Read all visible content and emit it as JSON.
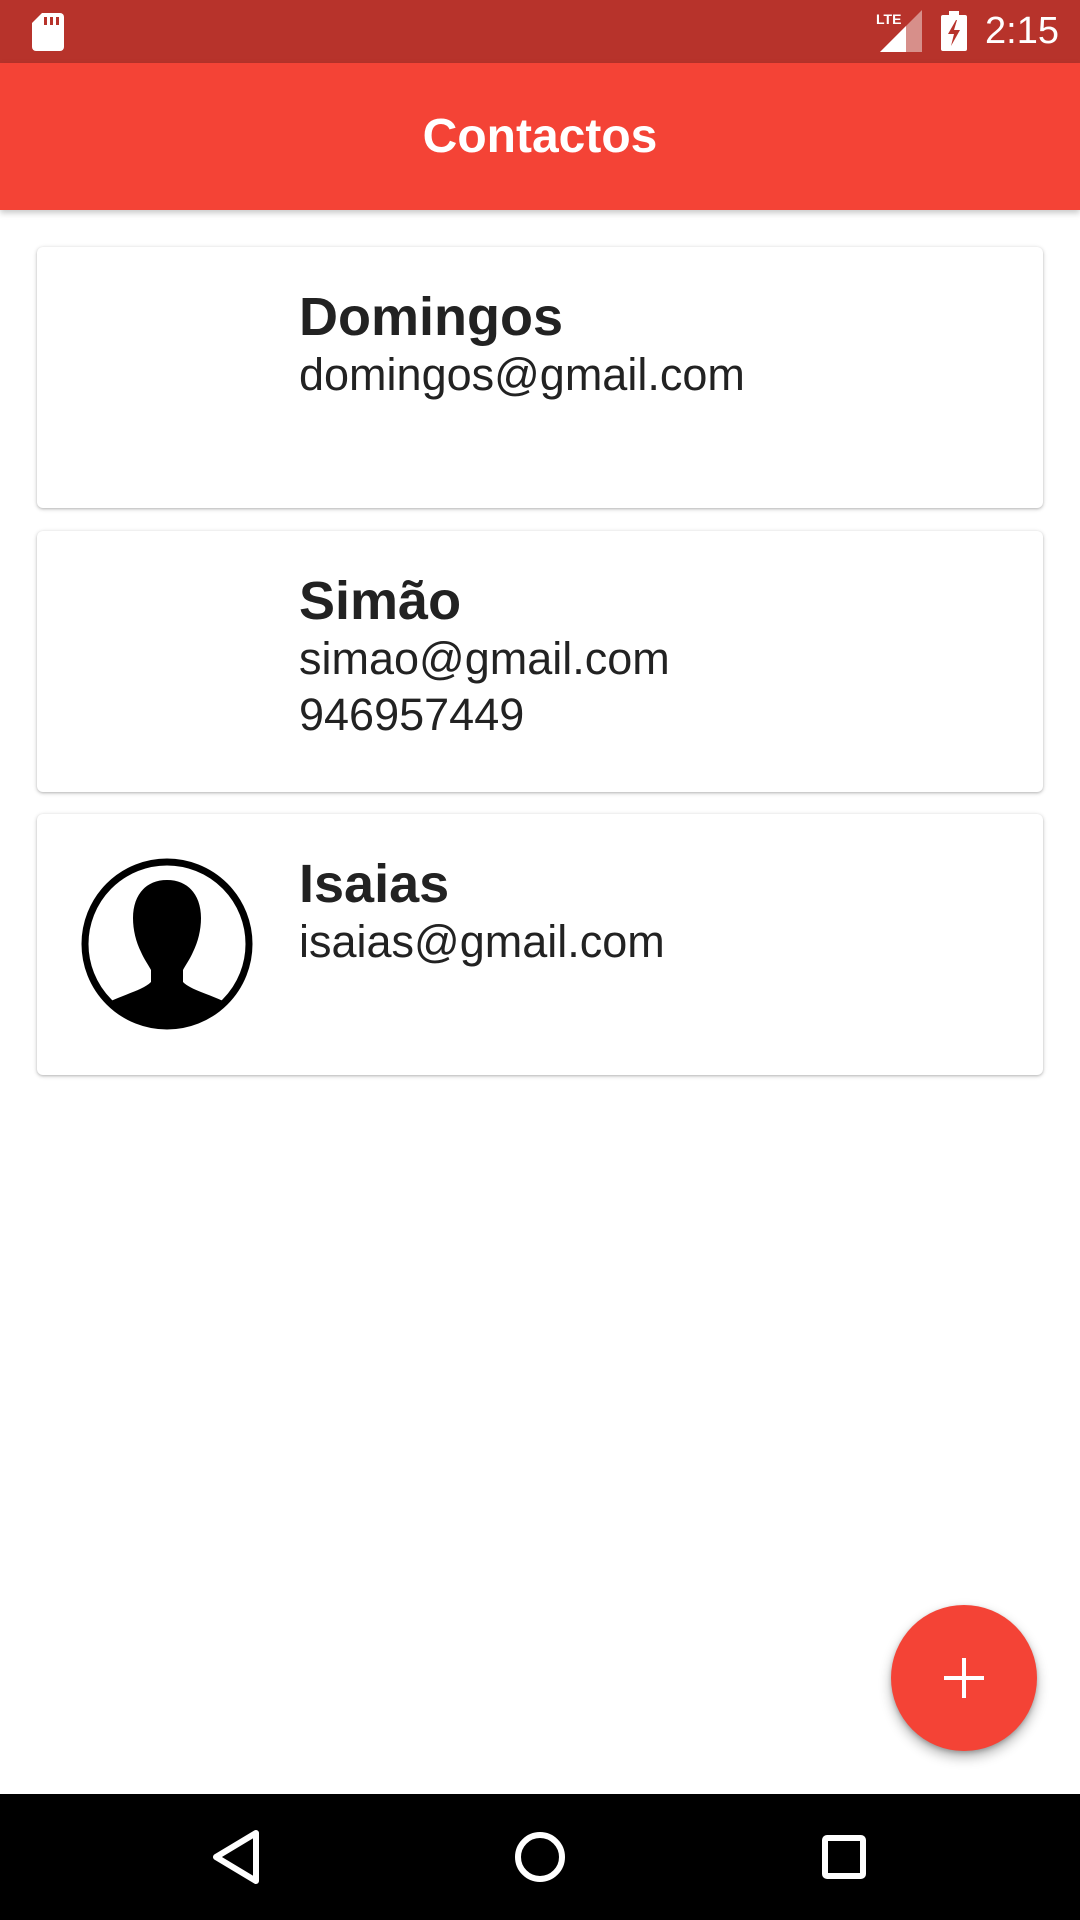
{
  "status_bar": {
    "time": "2:15",
    "network": "LTE",
    "icons": [
      "sd-card-icon",
      "lte-signal-icon",
      "battery-charging-icon"
    ]
  },
  "app_bar": {
    "title": "Contactos",
    "color": "#f44336"
  },
  "contacts": [
    {
      "name": "Domingos",
      "email": "domingos@gmail.com",
      "phone": "",
      "has_avatar": false
    },
    {
      "name": "Simão",
      "email": "simao@gmail.com",
      "phone": "946957449",
      "has_avatar": false
    },
    {
      "name": "Isaias",
      "email": "isaias@gmail.com",
      "phone": "",
      "has_avatar": true,
      "avatar_icon": "person-silhouette-icon"
    }
  ],
  "fab": {
    "icon": "plus-icon",
    "color": "#f44336"
  },
  "nav_bar": {
    "buttons": [
      "back-icon",
      "home-icon",
      "recents-icon"
    ]
  }
}
